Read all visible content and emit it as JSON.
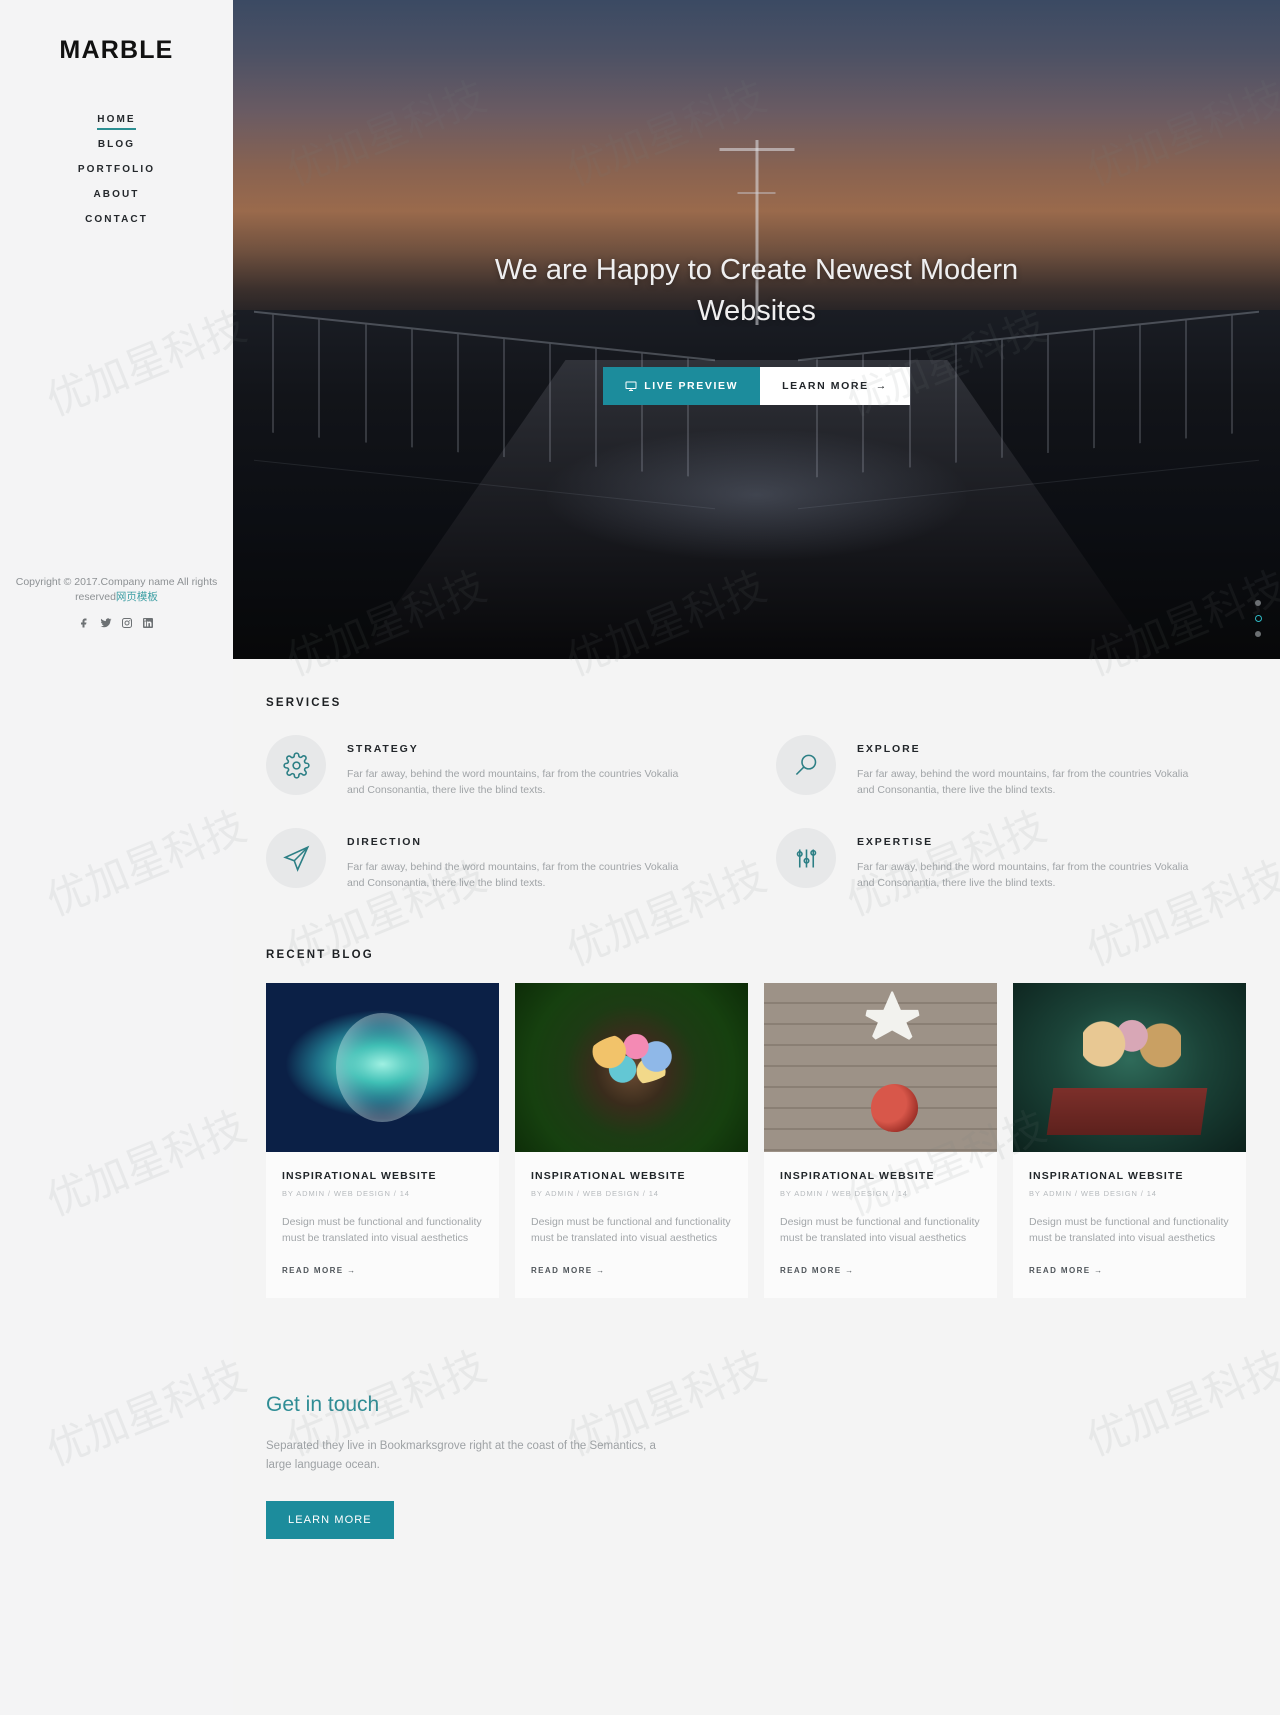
{
  "sidebar": {
    "logo": "MARBLE",
    "nav": [
      {
        "label": "HOME",
        "active": true
      },
      {
        "label": "BLOG",
        "active": false
      },
      {
        "label": "PORTFOLIO",
        "active": false
      },
      {
        "label": "ABOUT",
        "active": false
      },
      {
        "label": "CONTACT",
        "active": false
      }
    ],
    "copyright": "Copyright © 2017.Company name All rights reserved",
    "copyright_link": "网页模板",
    "socials": [
      "facebook-icon",
      "twitter-icon",
      "instagram-icon",
      "linkedin-icon"
    ]
  },
  "hero": {
    "title": "We are Happy to Create Newest Modern Websites",
    "live_preview": "LIVE PREVIEW",
    "learn_more": "LEARN MORE",
    "dots": 3,
    "active_dot": 1,
    "accent": "#1c8c9c"
  },
  "services": {
    "title": "SERVICES",
    "items": [
      {
        "name": "STRATEGY",
        "icon": "gear-icon",
        "desc": "Far far away, behind the word mountains, far from the countries Vokalia and Consonantia, there live the blind texts."
      },
      {
        "name": "EXPLORE",
        "icon": "magnifier-icon",
        "desc": "Far far away, behind the word mountains, far from the countries Vokalia and Consonantia, there live the blind texts."
      },
      {
        "name": "DIRECTION",
        "icon": "paper-plane-icon",
        "desc": "Far far away, behind the word mountains, far from the countries Vokalia and Consonantia, there live the blind texts."
      },
      {
        "name": "EXPERTISE",
        "icon": "sliders-icon",
        "desc": "Far far away, behind the word mountains, far from the countries Vokalia and Consonantia, there live the blind texts."
      }
    ]
  },
  "blog": {
    "title": "RECENT BLOG",
    "posts": [
      {
        "title": "INSPIRATIONAL WEBSITE",
        "meta": "BY ADMIN / WEB DESIGN / 14",
        "excerpt": "Design must be functional and functionality must be translated into visual aesthetics",
        "more": "READ MORE →"
      },
      {
        "title": "INSPIRATIONAL WEBSITE",
        "meta": "BY ADMIN / WEB DESIGN / 14",
        "excerpt": "Design must be functional and functionality must be translated into visual aesthetics",
        "more": "READ MORE →"
      },
      {
        "title": "INSPIRATIONAL WEBSITE",
        "meta": "BY ADMIN / WEB DESIGN / 14",
        "excerpt": "Design must be functional and functionality must be translated into visual aesthetics",
        "more": "READ MORE →"
      },
      {
        "title": "INSPIRATIONAL WEBSITE",
        "meta": "BY ADMIN / WEB DESIGN / 14",
        "excerpt": "Design must be functional and functionality must be translated into visual aesthetics",
        "more": "READ MORE →"
      }
    ]
  },
  "touch": {
    "title": "Get in touch",
    "desc": "Separated they live in Bookmarksgrove right at the coast of the Semantics, a large language ocean.",
    "button": "LEARN MORE"
  },
  "watermark": "优加星科技"
}
